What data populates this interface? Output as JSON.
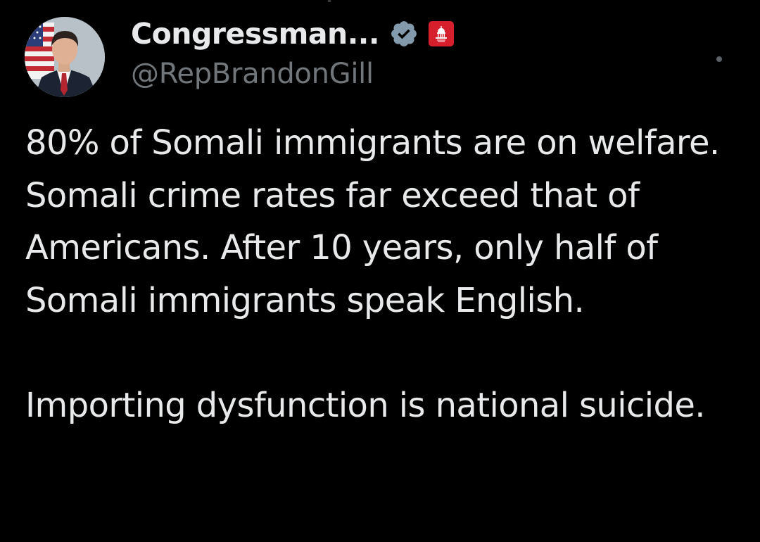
{
  "tweet": {
    "author": {
      "display_name": "Congressman...",
      "handle": "@RepBrandonGill",
      "avatar_icon": "profile-photo",
      "verified_icon": "verified-badge-icon",
      "affiliation_icon": "us-capitol-icon"
    },
    "more_icon": "more-options-icon",
    "text": {
      "paragraph_1": "80% of Somali immigrants are on welfare. Somali crime rates far exceed that of Americans. After 10 years, only half of Somali immigrants speak English.",
      "paragraph_2": "Importing dysfunction is national suicide."
    }
  },
  "colors": {
    "background": "#000000",
    "text_primary": "#e7e9ea",
    "text_secondary": "#71767b",
    "verified_badge": "#829aab",
    "affiliation_badge": "#d61f2c"
  }
}
